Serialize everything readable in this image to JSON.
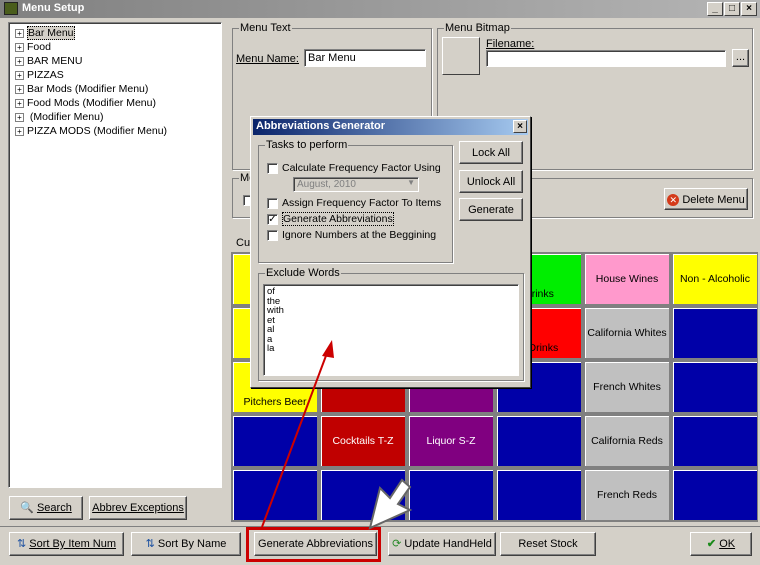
{
  "window": {
    "title": "Menu Setup",
    "controls": [
      "_",
      "□",
      "×"
    ]
  },
  "tree": {
    "items": [
      {
        "label": "Bar Menu",
        "selected": true
      },
      {
        "label": "Food"
      },
      {
        "label": "BAR MENU"
      },
      {
        "label": "PIZZAS"
      },
      {
        "label": "Bar Mods  (Modifier Menu)"
      },
      {
        "label": "Food Mods  (Modifier Menu)"
      },
      {
        "label": "  (Modifier Menu)"
      },
      {
        "label": "PIZZA MODS  (Modifier Menu)"
      }
    ]
  },
  "left_buttons": {
    "search": "Search",
    "abbrev": "Abbrev Exceptions"
  },
  "menu_text": {
    "legend": "Menu Text",
    "name_label": "Menu Name:",
    "name_value": "Bar Menu"
  },
  "menu_bitmap": {
    "legend": "Menu Bitmap",
    "filename_label": "Filename:",
    "filename_value": "",
    "browse": "..."
  },
  "partial_labels": {
    "me": "Me",
    "cur": "Cur"
  },
  "delete_menu": "Delete Menu",
  "grid": {
    "cells": [
      {
        "label": "Drinks",
        "color": "#00ee00"
      },
      {
        "label": "House Wines",
        "color": "#ff99cc"
      },
      {
        "label": "Non - Alcoholic",
        "color": "#ffff00"
      },
      {
        "label": "n Drinks",
        "color": "#ff0000"
      },
      {
        "label": "California Whites",
        "color": "#c0c0c0"
      },
      {
        "label": "Pitchers Beer",
        "color": "#ffff00"
      },
      {
        "label": "French Whites",
        "color": "#c0c0c0"
      },
      {
        "label": "Cocktails T-Z",
        "color": "#c00000"
      },
      {
        "label": "Liquor S-Z",
        "color": "#800080"
      },
      {
        "label": "California Reds",
        "color": "#c0c0c0"
      },
      {
        "label": "French Reds",
        "color": "#c0c0c0"
      }
    ],
    "blue": "#0000a8"
  },
  "dialog": {
    "title": "Abbreviations Generator",
    "close": "×",
    "tasks_legend": "Tasks to perform",
    "tasks": [
      {
        "label": "Calculate Frequency Factor Using",
        "checked": false
      },
      {
        "label": "Assign Frequency Factor To Items",
        "checked": false
      },
      {
        "label": "Generate Abbreviations",
        "checked": true
      },
      {
        "label": "Ignore Numbers at the Beggining",
        "checked": false
      }
    ],
    "date_select": "August, 2010",
    "buttons": {
      "lock": "Lock All",
      "unlock": "Unlock All",
      "generate": "Generate"
    },
    "exclude_legend": "Exclude Words",
    "exclude_words": [
      "of",
      "the",
      "with",
      "et",
      "al",
      "a",
      "la"
    ]
  },
  "bottom": {
    "sort_item": "Sort By Item Num",
    "sort_name": "Sort By Name",
    "gen_abbrev": "Generate Abbreviations",
    "update": "Update HandHeld",
    "reset": "Reset Stock",
    "ok": "OK"
  },
  "colors": {
    "highlight": "#cc0000",
    "face": "#d4d0c8",
    "dialog_title": "#0a246a"
  }
}
